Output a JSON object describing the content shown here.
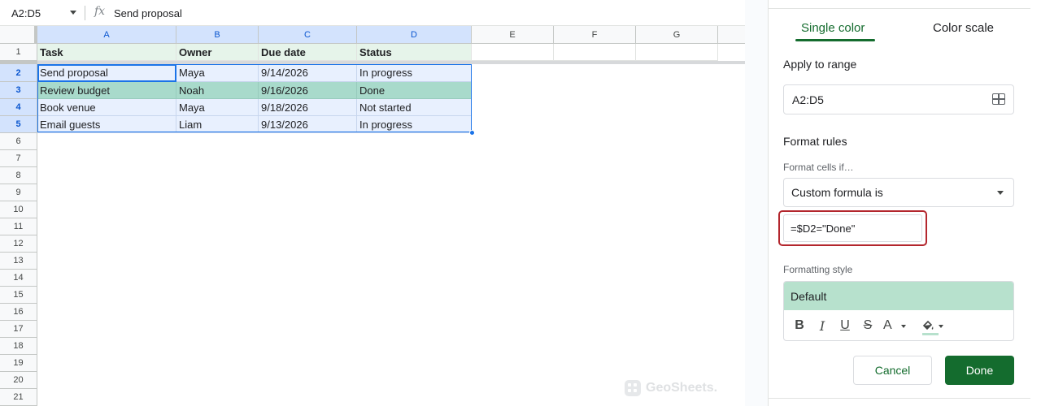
{
  "formula_bar": {
    "namebox": "A2:D5",
    "fx_symbol": "fx",
    "content": "Send proposal"
  },
  "sheet": {
    "columns": [
      "A",
      "B",
      "C",
      "D",
      "E",
      "F",
      "G"
    ],
    "rows": [
      "1",
      "2",
      "3",
      "4",
      "5",
      "6",
      "7",
      "8",
      "9",
      "10",
      "11",
      "12",
      "13",
      "14",
      "15",
      "16",
      "17",
      "18",
      "19",
      "20",
      "21"
    ],
    "header": [
      "Task",
      "Owner",
      "Due date",
      "Status"
    ],
    "data": [
      [
        "Send proposal",
        "Maya",
        "9/14/2026",
        "In progress"
      ],
      [
        "Review budget",
        "Noah",
        "9/16/2026",
        "Done"
      ],
      [
        "Book venue",
        "Maya",
        "9/18/2026",
        "Not started"
      ],
      [
        "Email guests",
        "Liam",
        "9/13/2026",
        "In progress"
      ]
    ],
    "highlight_color": "#a8dacb",
    "header_fill": "#e6f4ea"
  },
  "watermark": "GeoSheets.",
  "panel": {
    "tabs": [
      "Single color",
      "Color scale"
    ],
    "active_tab": "Single color",
    "apply_to_range_label": "Apply to range",
    "range_value": "A2:D5",
    "format_rules_label": "Format rules",
    "format_cells_if_label": "Format cells if…",
    "condition": "Custom formula is",
    "formula": "=$D2=\"Done\"",
    "formatting_style_label": "Formatting style",
    "style_preview": "Default",
    "style_fill": "#b7e1cd",
    "tools": [
      "B",
      "I",
      "U",
      "S",
      "A"
    ],
    "cancel_label": "Cancel",
    "done_label": "Done",
    "accent": "#146c2e"
  }
}
